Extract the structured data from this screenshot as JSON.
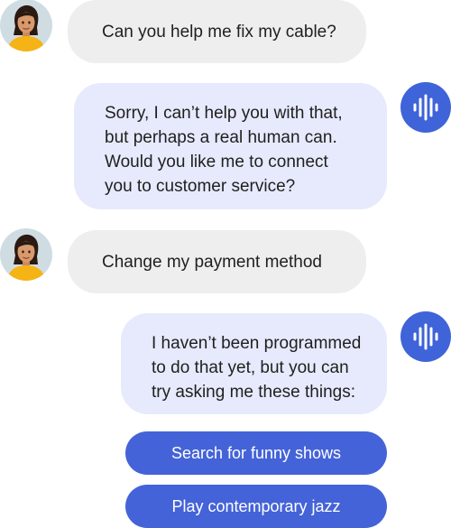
{
  "conversation": {
    "messages": [
      {
        "sender": "user",
        "avatar_icon": "woman-avatar-icon",
        "lines": [
          "Can you help me fix my cable?"
        ]
      },
      {
        "sender": "bot",
        "avatar_icon": "voice-waveform-icon",
        "lines": [
          "Sorry,  I can’t help you with that,",
          "but perhaps a real human can.",
          "Would you like me to connect",
          "you to customer service?"
        ]
      },
      {
        "sender": "user",
        "avatar_icon": "woman-avatar-icon",
        "lines": [
          "Change my payment method"
        ]
      },
      {
        "sender": "bot",
        "avatar_icon": "voice-waveform-icon",
        "lines": [
          "I haven’t been programmed",
          "to do that yet, but you can",
          "try asking me these things:"
        ]
      }
    ],
    "suggestions": [
      {
        "label": "Search for funny shows"
      },
      {
        "label": "Play contemporary jazz"
      }
    ]
  },
  "colors": {
    "user_bubble": "#eeeeee",
    "bot_bubble": "#e6eafc",
    "accent": "#4463d8",
    "bot_icon": "#3f63d8",
    "avatar_bg": "#cfdde3",
    "avatar_shirt": "#f5b315"
  }
}
